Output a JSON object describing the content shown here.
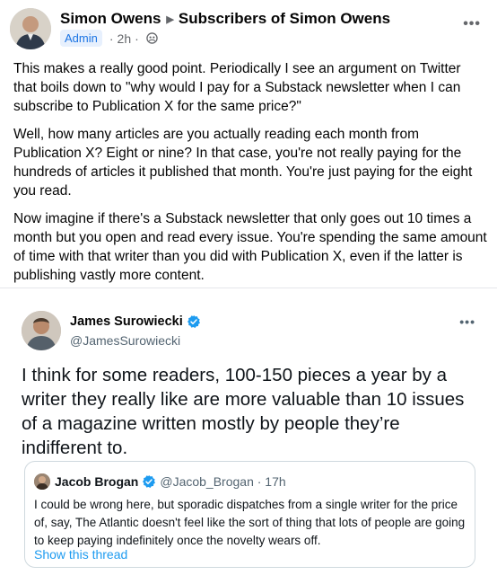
{
  "post": {
    "author": "Simon Owens",
    "group": "Subscribers of Simon Owens",
    "badge": "Admin",
    "time": "2h",
    "paragraphs": [
      "This makes a really good point. Periodically I see an argument on Twitter that boils down to \"why would I pay for a Substack newsletter when I can subscribe to Publication X for the same price?\"",
      "Well, how many articles are you actually reading each month from Publication X? Eight or nine? In that case, you're not really paying for the hundreds of articles it published that month. You're just paying for the eight you read.",
      "Now imagine if there's a Substack newsletter that only goes out 10 times a month but you open and read every issue. You're spending the same amount of time with that writer than you did with Publication X, even if the latter is publishing vastly more content."
    ],
    "more_icon": "more-horizontal-icon",
    "privacy_icon": "group-privacy-icon"
  },
  "tweet": {
    "name": "James Surowiecki",
    "handle": "@JamesSurowiecki",
    "text": "I think for some readers, 100-150 pieces a year by a writer they really like are more valuable than 10 issues of a magazine written mostly by people they’re indifferent to.",
    "verified_icon": "verified-badge-icon",
    "more_icon": "more-horizontal-icon",
    "quote": {
      "name": "Jacob Brogan",
      "handle": "@Jacob_Brogan · 17h",
      "text": "I could be wrong here, but sporadic dispatches from a single writer for the price of, say, The Atlantic doesn't feel like the sort of thing that lots of people are going to keep paying indefinitely once the novelty wears off.",
      "show_thread": "Show this thread"
    }
  },
  "colors": {
    "verified": "#1d9bf0",
    "link": "#1d9bf0",
    "admin_badge_bg": "#e7f0fd",
    "admin_badge_text": "#1b74e4"
  }
}
